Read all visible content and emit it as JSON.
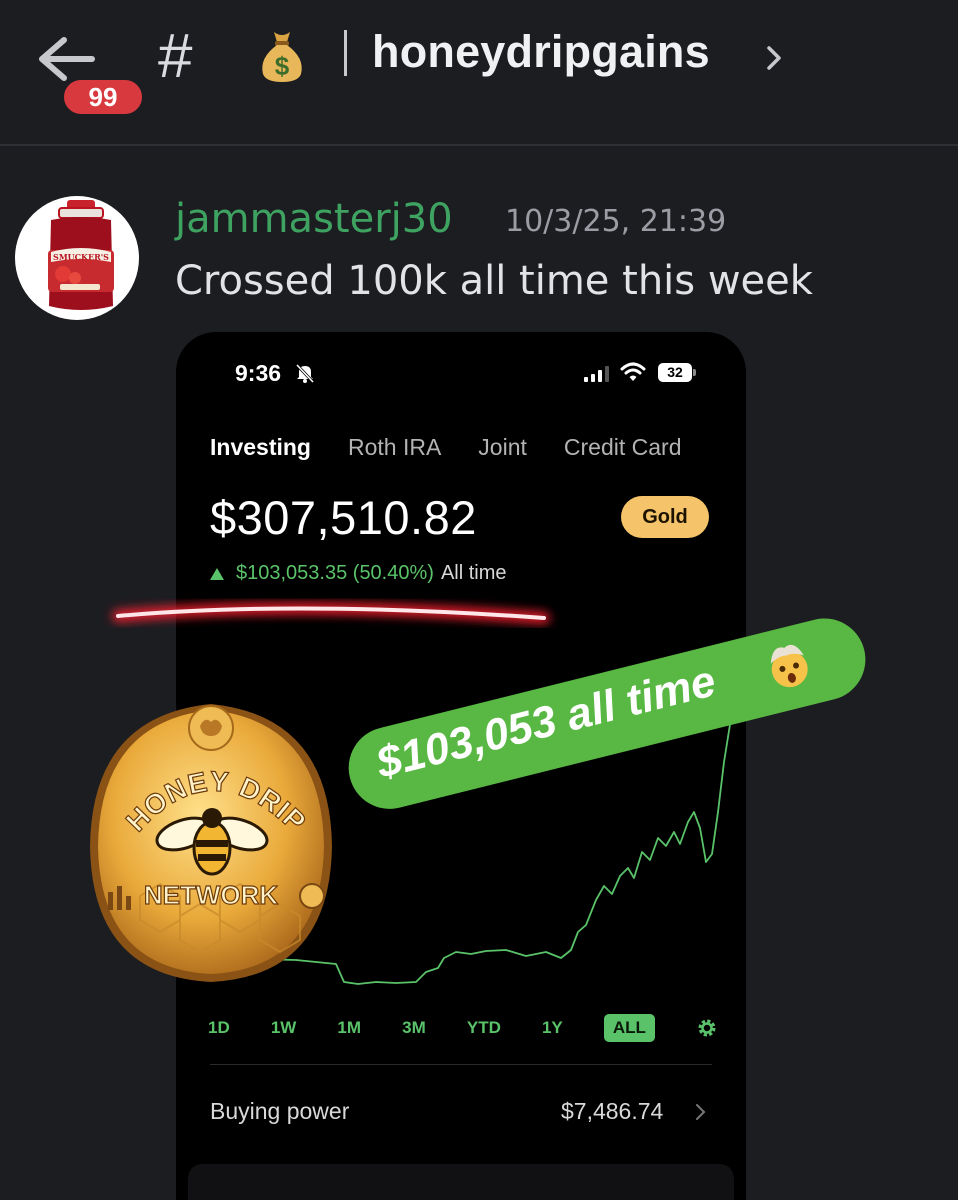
{
  "header": {
    "unread_count": "99",
    "channel_prefix": "#",
    "channel_emoji": "money-bag-icon",
    "channel_name": "honeydripgains"
  },
  "message": {
    "author": "jammasterj30",
    "timestamp": "10/3/25, 21:39",
    "text": "Crossed 100k all time this week",
    "avatar": "strawberry-jam-jar"
  },
  "phone": {
    "status_time": "9:36",
    "battery": "32",
    "tabs": [
      {
        "label": "Investing",
        "active": true
      },
      {
        "label": "Roth IRA",
        "active": false
      },
      {
        "label": "Joint",
        "active": false
      },
      {
        "label": "Credit Card",
        "active": false
      }
    ],
    "balance": "$307,510.82",
    "tier_badge": "Gold",
    "gain_value": "$103,053.35 (50.40%)",
    "gain_range": "All time",
    "ranges": [
      {
        "label": "1D",
        "active": false
      },
      {
        "label": "1W",
        "active": false
      },
      {
        "label": "1M",
        "active": false
      },
      {
        "label": "3M",
        "active": false
      },
      {
        "label": "YTD",
        "active": false
      },
      {
        "label": "1Y",
        "active": false
      },
      {
        "label": "ALL",
        "active": true
      }
    ],
    "buying_power_label": "Buying power",
    "buying_power_value": "$7,486.74"
  },
  "overlays": {
    "sticker_text": "$103,053 all time",
    "logo_top_text": "HONEY DRIP",
    "logo_bottom_text": "NETWORK"
  },
  "colors": {
    "accent_green": "#5ac36a",
    "username_green": "#3ea361",
    "gold": "#f4c36a",
    "badge_red": "#d8393f"
  }
}
